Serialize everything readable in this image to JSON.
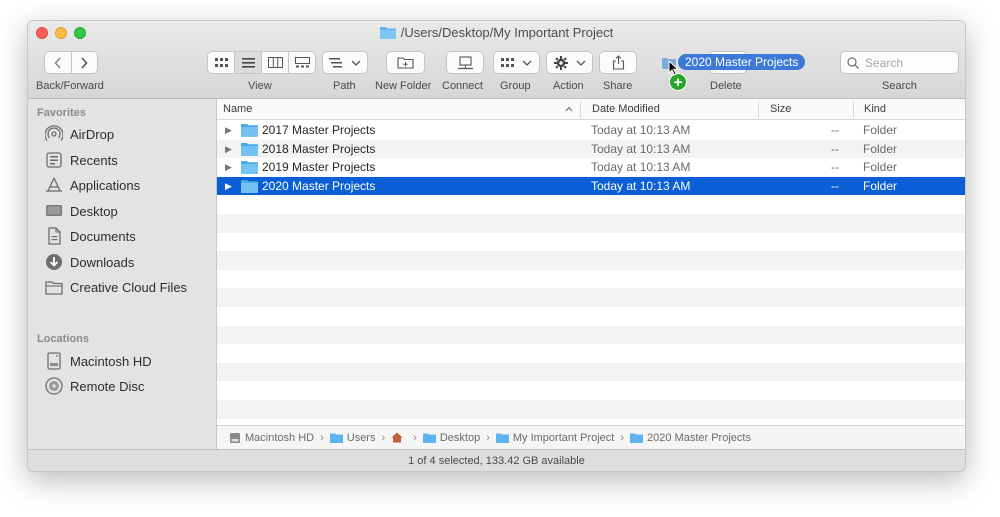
{
  "window": {
    "title": "/Users/Desktop/My Important Project"
  },
  "toolbar": {
    "back_forward_label": "Back/Forward",
    "view_label": "View",
    "path_label": "Path",
    "new_folder_label": "New Folder",
    "connect_label": "Connect",
    "group_label": "Group",
    "action_label": "Action",
    "share_label": "Share",
    "delete_label": "Delete",
    "search_label": "Search",
    "search_placeholder": "Search"
  },
  "drag": {
    "label": "2020 Master Projects"
  },
  "sidebar": {
    "favorites_heading": "Favorites",
    "favorites": [
      {
        "label": "AirDrop",
        "icon": "airdrop-icon"
      },
      {
        "label": "Recents",
        "icon": "recents-icon"
      },
      {
        "label": "Applications",
        "icon": "applications-icon"
      },
      {
        "label": "Desktop",
        "icon": "desktop-icon"
      },
      {
        "label": "Documents",
        "icon": "documents-icon"
      },
      {
        "label": "Downloads",
        "icon": "downloads-icon"
      },
      {
        "label": "Creative Cloud Files",
        "icon": "folder-icon"
      }
    ],
    "locations_heading": "Locations",
    "locations": [
      {
        "label": "Macintosh HD",
        "icon": "hard-drive-icon"
      },
      {
        "label": "Remote Disc",
        "icon": "disc-icon"
      }
    ]
  },
  "columns": {
    "name": "Name",
    "date": "Date Modified",
    "size": "Size",
    "kind": "Kind"
  },
  "files": [
    {
      "name": "2017 Master Projects",
      "date": "Today at 10:13 AM",
      "size": "--",
      "kind": "Folder",
      "selected": false
    },
    {
      "name": "2018 Master Projects",
      "date": "Today at 10:13 AM",
      "size": "--",
      "kind": "Folder",
      "selected": false
    },
    {
      "name": "2019 Master Projects",
      "date": "Today at 10:13 AM",
      "size": "--",
      "kind": "Folder",
      "selected": false
    },
    {
      "name": "2020 Master Projects",
      "date": "Today at 10:13 AM",
      "size": "--",
      "kind": "Folder",
      "selected": true
    }
  ],
  "pathbar": [
    "Macintosh HD",
    "Users",
    "",
    "Desktop",
    "My Important Project",
    "2020 Master Projects"
  ],
  "status": "1 of 4 selected, 133.42 GB available",
  "colors": {
    "selection": "#0b5fd6",
    "folder": "#5eb3ee",
    "drag_plus": "#2aa52a"
  }
}
